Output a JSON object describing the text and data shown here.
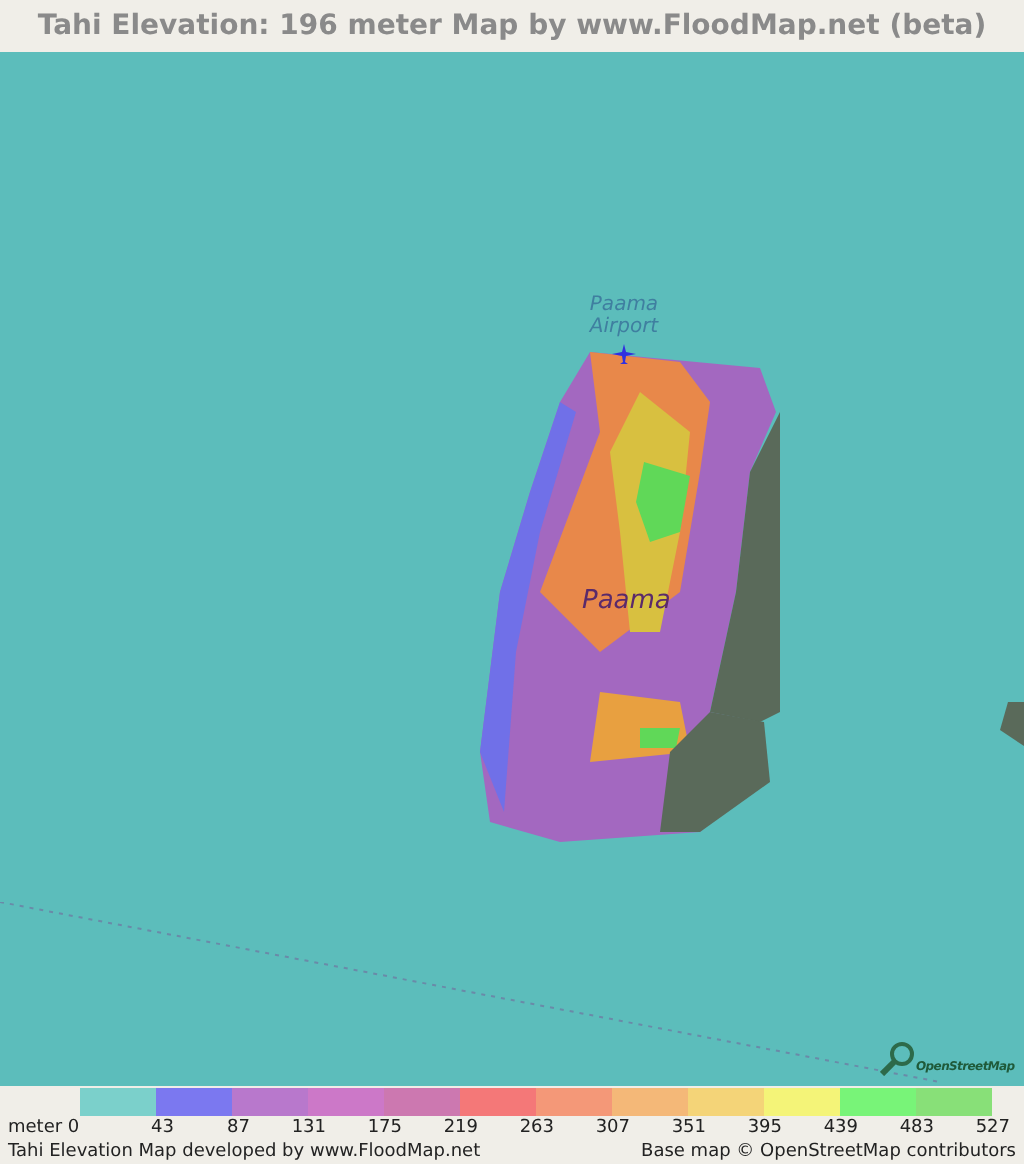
{
  "title": "Tahi Elevation: 196 meter Map by www.FloodMap.net (beta)",
  "map": {
    "labels": [
      {
        "kind": "airport",
        "text": "Paama\nAirport"
      },
      {
        "kind": "island",
        "text": "Paama"
      }
    ],
    "logo_text": "OpenStreetMap"
  },
  "legend": {
    "swatches": [
      {
        "color": "#7bd0cb"
      },
      {
        "color": "#7b78f0"
      },
      {
        "color": "#b878cc"
      },
      {
        "color": "#cc78c8"
      },
      {
        "color": "#cc78b0"
      },
      {
        "color": "#f47878"
      },
      {
        "color": "#f49878"
      },
      {
        "color": "#f4b878"
      },
      {
        "color": "#f4d478"
      },
      {
        "color": "#f4f478"
      },
      {
        "color": "#78f478"
      },
      {
        "color": "#88e078"
      }
    ],
    "ticks": [
      "meter 0",
      "43",
      "87",
      "131",
      "175",
      "219",
      "263",
      "307",
      "351",
      "395",
      "439",
      "483",
      "527"
    ]
  },
  "footer": {
    "left": "Tahi Elevation Map developed by www.FloodMap.net",
    "right": "Base map © OpenStreetMap contributors"
  }
}
